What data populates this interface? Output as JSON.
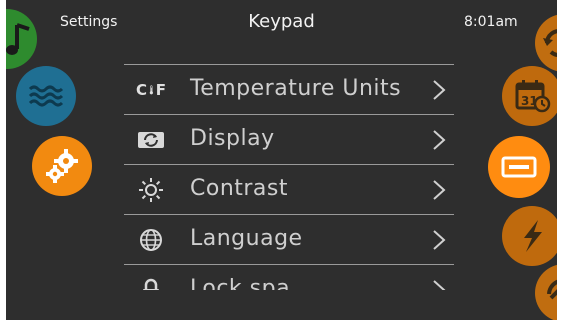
{
  "header": {
    "left_label": "Settings",
    "title": "Keypad",
    "time": "8:01am"
  },
  "left_nav": [
    {
      "icon": "music-note-icon",
      "color": "#2e8b2e"
    },
    {
      "icon": "water-waves-icon",
      "color": "#1f6f93"
    },
    {
      "icon": "gears-icon",
      "color": "#f28a10",
      "active": true
    }
  ],
  "right_nav": [
    {
      "icon": "undo-icon",
      "color": "#c06d10"
    },
    {
      "icon": "calendar-clock-icon",
      "color": "#bf6a0d",
      "text": "31"
    },
    {
      "icon": "keypad-icon",
      "color": "#ff8c10",
      "active": true
    },
    {
      "icon": "lightning-icon",
      "color": "#bf6a0d"
    },
    {
      "icon": "extension-icon",
      "color": "#c06d10"
    }
  ],
  "menu": {
    "items": [
      {
        "label": "Temperature Units",
        "icon": "thermometer-cf-icon",
        "icon_text_c": "C",
        "icon_text_f": "F"
      },
      {
        "label": "Display",
        "icon": "display-rotate-icon"
      },
      {
        "label": "Contrast",
        "icon": "sun-icon"
      },
      {
        "label": "Language",
        "icon": "globe-icon"
      },
      {
        "label": "Lock spa",
        "icon": "lock-icon"
      }
    ]
  }
}
